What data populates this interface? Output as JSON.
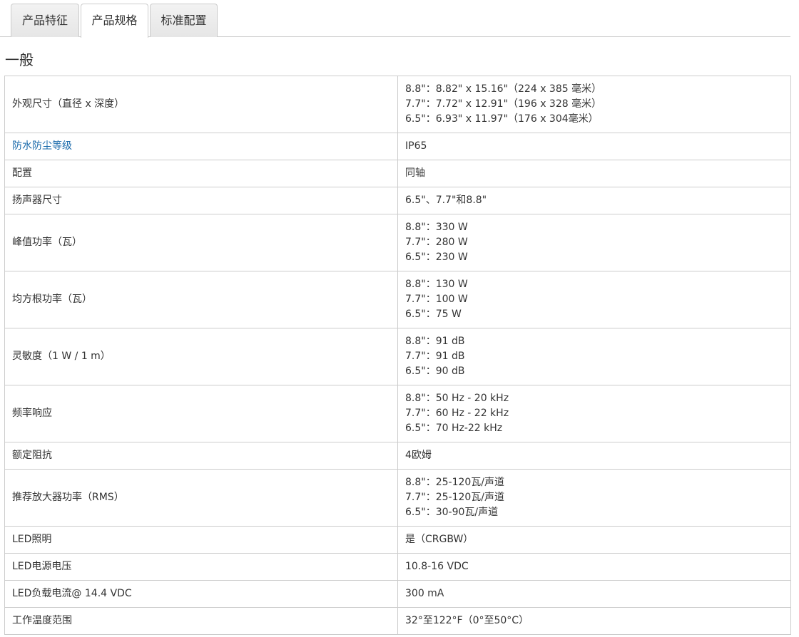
{
  "tabs": [
    {
      "label": "产品特征",
      "active": false
    },
    {
      "label": "产品规格",
      "active": true
    },
    {
      "label": "标准配置",
      "active": false
    }
  ],
  "section_title": "一般",
  "link_color": "#1a6aab",
  "specs": [
    {
      "label": "外观尺寸（直径 x 深度）",
      "link": false,
      "values": [
        "8.8\"：8.82\" x 15.16\"（224 x 385 毫米）",
        "7.7\"：7.72\" x 12.91\"（196 x 328 毫米）",
        "6.5\"：6.93\" x 11.97\"（176 x 304毫米）"
      ]
    },
    {
      "label": "防水防尘等级",
      "link": true,
      "values": [
        "IP65"
      ]
    },
    {
      "label": "配置",
      "link": false,
      "values": [
        "同轴"
      ]
    },
    {
      "label": "扬声器尺寸",
      "link": false,
      "values": [
        "6.5\"、7.7\"和8.8\""
      ]
    },
    {
      "label": "峰值功率（瓦）",
      "link": false,
      "values": [
        "8.8\"：330 W",
        "7.7\"：280 W",
        "6.5\"：230 W"
      ]
    },
    {
      "label": "均方根功率（瓦）",
      "link": false,
      "values": [
        "8.8\"：130 W",
        "7.7\"：100 W",
        "6.5\"：75 W"
      ]
    },
    {
      "label": "灵敏度（1 W / 1 m）",
      "link": false,
      "values": [
        "8.8\"：91 dB",
        "7.7\"：91 dB",
        "6.5\"：90 dB"
      ]
    },
    {
      "label": "频率响应",
      "link": false,
      "values": [
        "8.8\"：50 Hz - 20 kHz",
        "7.7\"：60 Hz - 22 kHz",
        "6.5\"：70 Hz-22 kHz"
      ]
    },
    {
      "label": "额定阻抗",
      "link": false,
      "values": [
        "4欧姆"
      ]
    },
    {
      "label": "推荐放大器功率（RMS）",
      "link": false,
      "values": [
        "8.8\"：25-120瓦/声道",
        "7.7\"：25-120瓦/声道",
        "6.5\"：30-90瓦/声道"
      ]
    },
    {
      "label": "LED照明",
      "link": false,
      "values": [
        "是（CRGBW）"
      ]
    },
    {
      "label": "LED电源电压",
      "link": false,
      "values": [
        "10.8-16 VDC"
      ]
    },
    {
      "label": "LED负载电流@ 14.4 VDC",
      "link": false,
      "values": [
        "300 mA"
      ]
    },
    {
      "label": "工作温度范围",
      "link": false,
      "values": [
        "32°至122°F（0°至50°C）"
      ]
    }
  ]
}
